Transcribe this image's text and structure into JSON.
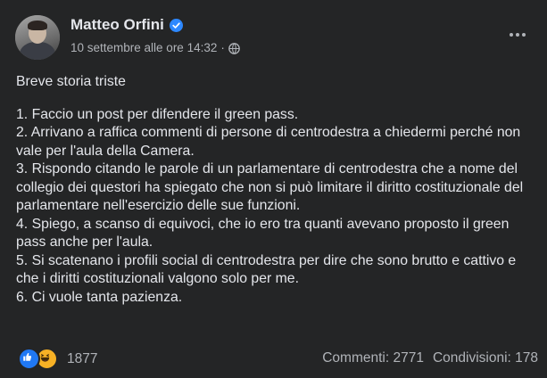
{
  "post": {
    "author": "Matteo Orfini",
    "timestamp": "10 settembre alle ore 14:32",
    "separator": "·",
    "privacy_icon": "globe-icon",
    "verified_icon": "verified-badge-icon",
    "more_icon": "more-options-icon",
    "title": "Breve storia triste",
    "lines": [
      "1. Faccio un post per difendere il green pass.",
      "2. Arrivano a raffica commenti di persone di centrodestra a chiedermi perché non vale per l'aula della Camera.",
      "3. Rispondo citando le parole di un parlamentare di centrodestra che a nome del collegio dei questori ha spiegato che non si può limitare il diritto costituzionale del parlamentare nell'esercizio delle sue funzioni.",
      "4. Spiego, a scanso di equivoci, che io ero tra quanti avevano proposto il green pass anche per l'aula.",
      "5. Si scatenano i profili social di centrodestra per dire che sono brutto e cattivo e che i diritti costituzionali valgono solo per me.",
      "6. Ci vuole tanta pazienza."
    ]
  },
  "footer": {
    "reaction_icons": [
      "like-icon",
      "haha-icon"
    ],
    "reaction_count": "1877",
    "comments": "Commenti: 2771",
    "shares": "Condivisioni: 178"
  },
  "colors": {
    "background": "#242526",
    "text": "#e4e6eb",
    "secondary": "#b0b3b8",
    "accent": "#2078f4"
  }
}
